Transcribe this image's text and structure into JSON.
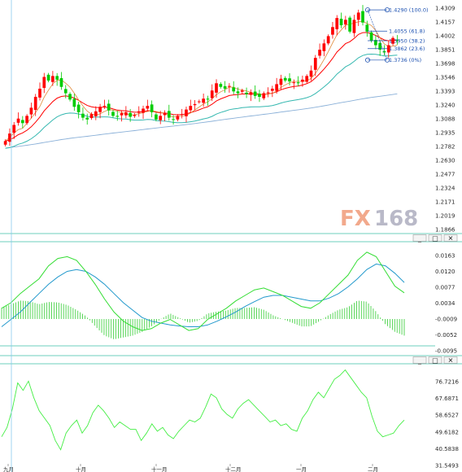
{
  "watermark": {
    "prefix": "FX",
    "suffix": "168"
  },
  "panel_buttons": [
    "minimize-button",
    "restore-button",
    "close-button"
  ],
  "panel_button_glyphs": [
    "_",
    "□",
    "✕"
  ],
  "colors": {
    "bull": "#ff0000",
    "bear": "#00cc00",
    "ma_fast": "#e08a3a",
    "ma_mid": "#ff0000",
    "ma_slow": "#35b8b0",
    "ma_long": "#8ab0d8",
    "macd_line": "#33dd33",
    "signal_line": "#2299cc",
    "histogram": "#33cc33",
    "oscillator": "#44ee44",
    "separator": "#3bbfa8",
    "crosshair": "#88ccee",
    "fib": "#1a4fb0"
  },
  "chart_data": [
    {
      "type": "candlestick",
      "y_ticks": [
        "1.4309",
        "1.4157",
        "1.4002",
        "1.3851",
        "1.3698",
        "1.3546",
        "1.3393",
        "1.3240",
        "1.3088",
        "1.2935",
        "1.2782",
        "1.2630",
        "1.2477",
        "1.2324",
        "1.2171",
        "1.2019",
        "1.1866"
      ],
      "ylim": [
        1.1866,
        1.4309
      ],
      "x_ticks": [
        "九月",
        "十月",
        "十一月",
        "十二月",
        "一月",
        "二月"
      ],
      "fib_levels": [
        {
          "label": "1.4290 (100.0)",
          "value": 1.429
        },
        {
          "label": "1.4055 (61.8)",
          "value": 1.4055
        },
        {
          "label": "1.3950 (38.2)",
          "value": 1.395
        },
        {
          "label": "1.3862 (23.6)",
          "value": 1.3862
        },
        {
          "label": "1.3736 (0%)",
          "value": 1.3736
        }
      ],
      "closes": [
        1.2842,
        1.2925,
        1.302,
        1.309,
        1.304,
        1.312,
        1.321,
        1.333,
        1.342,
        1.355,
        1.351,
        1.356,
        1.352,
        1.344,
        1.337,
        1.33,
        1.322,
        1.316,
        1.31,
        1.308,
        1.314,
        1.317,
        1.322,
        1.323,
        1.318,
        1.312,
        1.311,
        1.315,
        1.316,
        1.311,
        1.313,
        1.317,
        1.32,
        1.323,
        1.316,
        1.308,
        1.312,
        1.315,
        1.31,
        1.308,
        1.312,
        1.314,
        1.319,
        1.323,
        1.325,
        1.328,
        1.331,
        1.33,
        1.34,
        1.348,
        1.344,
        1.342,
        1.345,
        1.339,
        1.337,
        1.34,
        1.336,
        1.338,
        1.334,
        1.333,
        1.337,
        1.338,
        1.342,
        1.347,
        1.353,
        1.351,
        1.35,
        1.349,
        1.348,
        1.352,
        1.356,
        1.362,
        1.376,
        1.385,
        1.392,
        1.4,
        1.41,
        1.42,
        1.412,
        1.418,
        1.405,
        1.418,
        1.426,
        1.415,
        1.405,
        1.395,
        1.39,
        1.385,
        1.382,
        1.39,
        1.398,
        1.395
      ]
    },
    {
      "type": "macd",
      "y_ticks": [
        "0.0163",
        "0.0120",
        "0.0077",
        "0.0034",
        "-0.0009",
        "-0.0052",
        "-0.0095"
      ],
      "ylim": [
        -0.0095,
        0.0163
      ],
      "macd": [
        0.002,
        0.0035,
        0.006,
        0.008,
        0.01,
        0.0135,
        0.0155,
        0.016,
        0.015,
        0.012,
        0.0085,
        0.0045,
        0.001,
        -0.0015,
        -0.003,
        -0.004,
        -0.0035,
        -0.002,
        -0.001,
        -0.0025,
        -0.004,
        -0.0035,
        -0.001,
        0.0005,
        0.002,
        0.004,
        0.0055,
        0.007,
        0.0075,
        0.0065,
        0.0055,
        0.004,
        0.0025,
        0.002,
        0.0035,
        0.006,
        0.0085,
        0.011,
        0.015,
        0.0172,
        0.016,
        0.012,
        0.008,
        0.0062
      ],
      "signal": [
        -0.003,
        -0.001,
        0.001,
        0.0035,
        0.006,
        0.0085,
        0.0105,
        0.012,
        0.0125,
        0.012,
        0.0105,
        0.0085,
        0.006,
        0.0035,
        0.0015,
        -0.0005,
        -0.0015,
        -0.002,
        -0.0025,
        -0.0028,
        -0.003,
        -0.003,
        -0.0025,
        -0.0015,
        -0.0003,
        0.001,
        0.0025,
        0.0038,
        0.005,
        0.0055,
        0.0055,
        0.005,
        0.0045,
        0.004,
        0.004,
        0.0048,
        0.006,
        0.0078,
        0.01,
        0.0125,
        0.014,
        0.0135,
        0.0115,
        0.009
      ],
      "histogram": [
        0.003,
        0.004,
        0.005,
        0.0048,
        0.004,
        0.0046,
        0.0045,
        0.0038,
        0.0025,
        0.0008,
        -0.002,
        -0.0045,
        -0.0055,
        -0.005,
        -0.0045,
        -0.0035,
        -0.002,
        0.0,
        0.0015,
        0.0003,
        -0.001,
        -0.0005,
        0.0015,
        0.002,
        0.0023,
        0.003,
        0.003,
        0.0032,
        0.0025,
        0.001,
        0.0,
        -0.001,
        -0.002,
        -0.002,
        -0.0005,
        0.0012,
        0.0025,
        0.0032,
        0.005,
        0.0047,
        0.002,
        -0.0015,
        -0.0035,
        -0.0045
      ]
    },
    {
      "type": "line",
      "y_ticks": [
        "76.7216",
        "67.6871",
        "58.6527",
        "49.6182",
        "40.5838",
        "31.5493"
      ],
      "ylim": [
        31.5493,
        85
      ],
      "values": [
        47,
        52,
        62,
        76,
        72,
        77,
        68,
        61,
        57,
        53,
        45,
        40,
        49,
        53,
        56,
        49,
        53,
        60,
        64,
        61,
        57,
        52,
        55,
        53,
        51,
        51,
        45,
        49,
        54,
        50,
        52,
        48,
        46,
        50,
        53,
        56,
        55,
        57,
        63,
        70,
        68,
        62,
        59,
        57,
        62,
        65,
        67,
        64,
        61,
        58,
        55,
        56,
        53,
        54,
        51,
        50,
        57,
        61,
        67,
        71,
        68,
        73,
        78,
        80,
        83,
        79,
        75,
        71,
        68,
        58,
        50,
        47,
        48,
        49,
        53,
        56
      ]
    }
  ]
}
